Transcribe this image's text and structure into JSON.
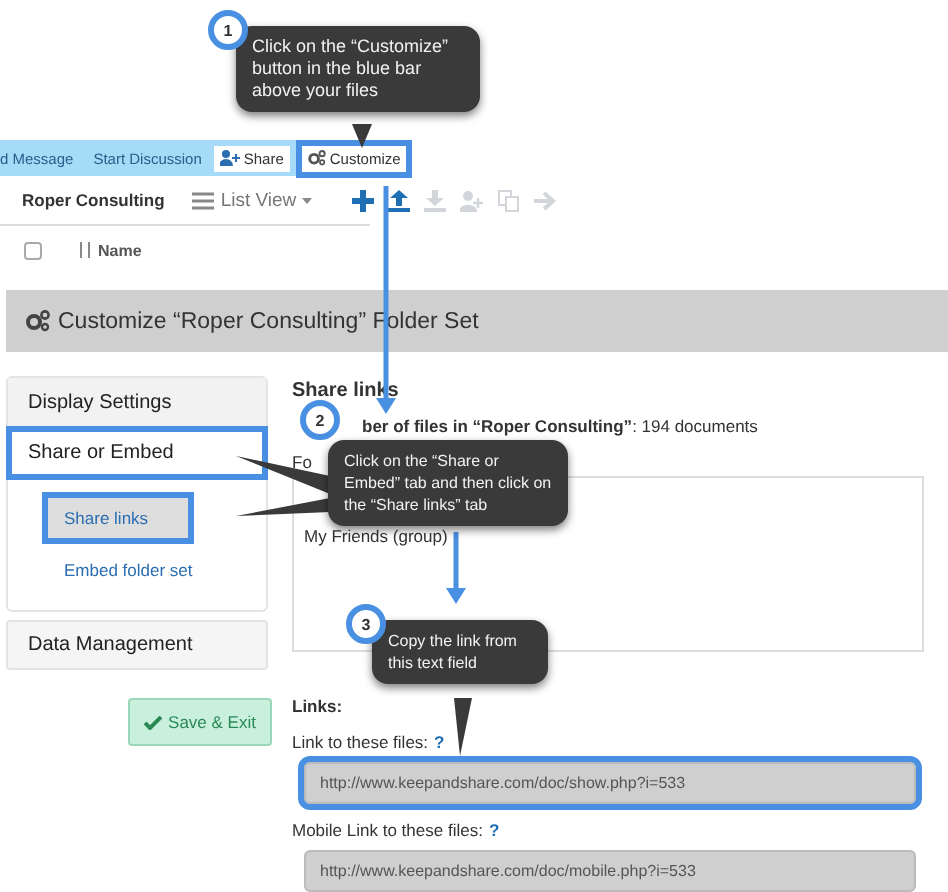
{
  "callouts": [
    {
      "number": "1",
      "text": "Click on the “Customize” button in the blue bar above your files"
    },
    {
      "number": "2",
      "text": "Click on the “Share or Embed” tab and then click on the “Share links” tab"
    },
    {
      "number": "3",
      "text": "Copy the link from this text field"
    }
  ],
  "action_bar": {
    "items": [
      {
        "kind": "link",
        "label": "d Message",
        "highlighted": false
      },
      {
        "kind": "link",
        "label": "Start Discussion",
        "highlighted": false
      },
      {
        "kind": "share",
        "label": "Share",
        "highlighted": false
      },
      {
        "kind": "customize",
        "label": "Customize",
        "highlighted": true
      }
    ]
  },
  "toolbar": {
    "folder": "Roper Consulting",
    "view": "List View",
    "actions": [
      {
        "kind": "add",
        "enabled": true
      },
      {
        "kind": "upload",
        "enabled": true
      },
      {
        "kind": "download",
        "enabled": false
      },
      {
        "kind": "add-user",
        "enabled": false
      },
      {
        "kind": "copy",
        "enabled": false
      },
      {
        "kind": "move",
        "enabled": false
      }
    ]
  },
  "file_list": {
    "select_all_checked": false,
    "columns": [
      "Name"
    ]
  },
  "panel": {
    "title": "Customize “Roper Consulting” Folder Set"
  },
  "sidebar": {
    "items": [
      {
        "label": "Display Settings",
        "highlighted": false
      },
      {
        "label": "Share or Embed",
        "highlighted": true,
        "children": [
          {
            "label": "Share links",
            "selected": true,
            "highlighted": true
          },
          {
            "label": "Embed folder set",
            "selected": false,
            "highlighted": false
          }
        ]
      },
      {
        "label": "Data Management",
        "highlighted": false
      }
    ]
  },
  "save_button": "Save & Exit",
  "content": {
    "heading": "Share links",
    "file_count": "**ber of files in “Roper Consulting”**: 194 documents",
    "folder_label": "Fo",
    "folder_lines": [
      "My Friends (group)"
    ],
    "links_heading": "Links:",
    "links": [
      {
        "label": "Link to these files:",
        "help": "?",
        "value": "http://www.keepandshare.com/doc/show.php?i=533",
        "highlighted": true
      },
      {
        "label": "Mobile Link to these files:",
        "help": "?",
        "value": "http://www.keepandshare.com/doc/mobile.php?i=533",
        "highlighted": false
      }
    ]
  }
}
